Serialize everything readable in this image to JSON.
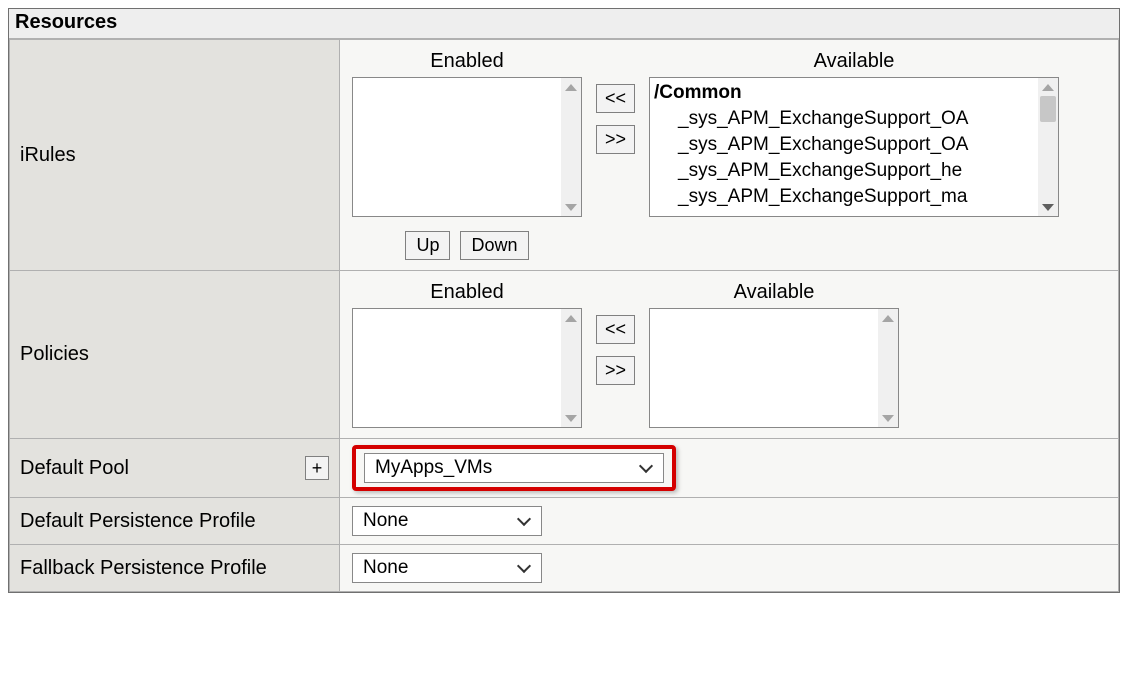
{
  "panel": {
    "title": "Resources"
  },
  "rows": {
    "irules": {
      "label": "iRules",
      "enabled_header": "Enabled",
      "available_header": "Available",
      "available_group": "/Common",
      "available_items": [
        "_sys_APM_ExchangeSupport_OA",
        "_sys_APM_ExchangeSupport_OA",
        "_sys_APM_ExchangeSupport_he",
        "_sys_APM_ExchangeSupport_ma"
      ],
      "btn_left": "<<",
      "btn_right": ">>",
      "btn_up": "Up",
      "btn_down": "Down"
    },
    "policies": {
      "label": "Policies",
      "enabled_header": "Enabled",
      "available_header": "Available",
      "btn_left": "<<",
      "btn_right": ">>"
    },
    "default_pool": {
      "label": "Default Pool",
      "plus": "+",
      "value": "MyApps_VMs"
    },
    "default_persistence": {
      "label": "Default Persistence Profile",
      "value": "None"
    },
    "fallback_persistence": {
      "label": "Fallback Persistence Profile",
      "value": "None"
    }
  }
}
